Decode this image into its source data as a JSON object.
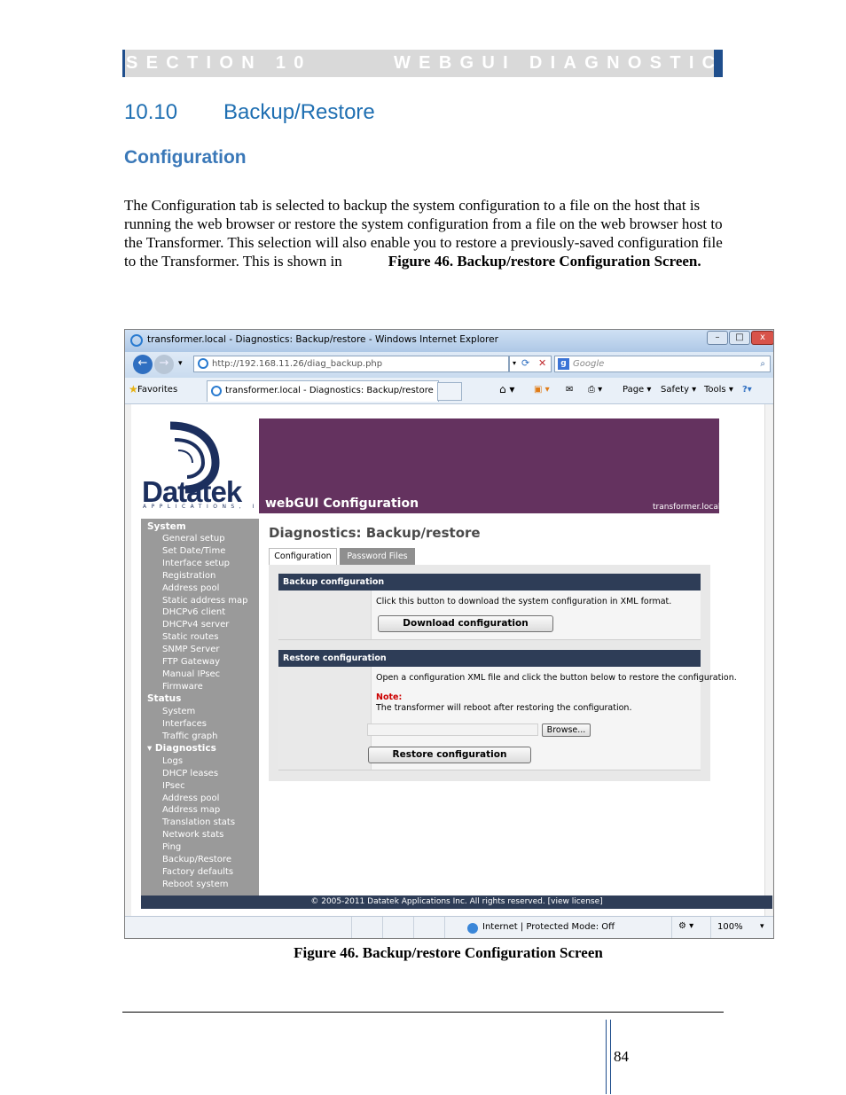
{
  "header": {
    "section_label": "SECTION 10",
    "section_title": "WEBGUI DIAGNOSTICS"
  },
  "heading": {
    "number": "10.10",
    "title": "Backup/Restore",
    "subheading": "Configuration"
  },
  "body": {
    "paragraph": "The Configuration tab is selected to backup the system configuration to a file on the host that is running the web browser or restore the system configuration from a file on the web browser host to the Transformer. This selection will also enable you to restore a previously-saved configuration file to the Transformer.  This is shown in",
    "figure_ref": "Figure 46. Backup/restore Configuration Screen."
  },
  "browser": {
    "window_title": "transformer.local - Diagnostics: Backup/restore - Windows Internet Explorer",
    "url": "http://192.168.11.26/diag_backup.php",
    "search_placeholder": "Google",
    "favorites_label": "Favorites",
    "tab_title": "transformer.local - Diagnostics: Backup/restore",
    "commands": [
      "Page ▾",
      "Safety ▾",
      "Tools ▾"
    ],
    "status_zone": "Internet | Protected Mode: Off",
    "zoom": "100%"
  },
  "webgui": {
    "logo_text": "Datatek",
    "logo_subtext": "APPLICATIONS, INC",
    "banner_title": "webGUI Configuration",
    "banner_host": "transformer.local",
    "nav": {
      "system_header": "System",
      "system_items": [
        "General setup",
        "Set Date/Time",
        "Interface setup",
        "Registration",
        "Address pool",
        "Static address map",
        "DHCPv6 client",
        "DHCPv4 server",
        "Static routes",
        "SNMP Server",
        "FTP Gateway",
        "Manual IPsec",
        "Firmware"
      ],
      "status_header": "Status",
      "status_items": [
        "System",
        "Interfaces",
        "Traffic graph"
      ],
      "diagnostics_header": "▾ Diagnostics",
      "diagnostics_items": [
        "Logs",
        "DHCP leases",
        "IPsec",
        "Address pool",
        "Address map",
        "Translation stats",
        "Network stats",
        "Ping",
        "Backup/Restore",
        "Factory defaults",
        "Reboot system"
      ]
    },
    "page_title": "Diagnostics: Backup/restore",
    "tabs": [
      "Configuration",
      "Password Files"
    ],
    "backup": {
      "header": "Backup configuration",
      "text": "Click this button to download the system configuration in XML format.",
      "button": "Download configuration"
    },
    "restore": {
      "header": "Restore configuration",
      "text": "Open a configuration XML file and click the button below to restore the configuration.",
      "note_label": "Note:",
      "note_text": "The transformer will reboot after restoring the configuration.",
      "browse_button": "Browse...",
      "button": "Restore configuration"
    },
    "footer": "© 2005-2011 Datatek Applications Inc. All rights reserved.  [view license]"
  },
  "caption": "Figure 46. Backup/restore Configuration Screen",
  "page_number": "84",
  "colors": {
    "heading_blue": "#1f6fb2",
    "section_bar": "#1f4e8c",
    "banner_purple": "#64325f",
    "nav_gray": "#9a9a9a",
    "section_header_navy": "#2e3d57",
    "note_red": "#cc0000"
  }
}
